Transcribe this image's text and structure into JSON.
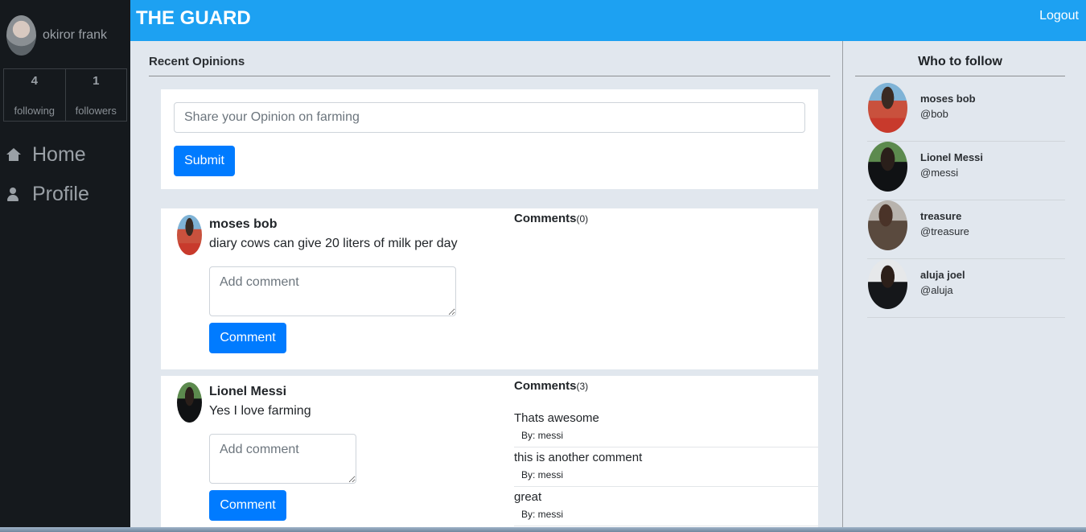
{
  "sidebar": {
    "user_name": "okiror frank",
    "following_count": "4",
    "following_label": "following",
    "followers_count": "1",
    "followers_label": "followers",
    "nav": [
      {
        "label": "Home",
        "icon": "home-icon"
      },
      {
        "label": "Profile",
        "icon": "user-icon"
      }
    ]
  },
  "header": {
    "brand": "THE GUARD",
    "logout_label": "Logout"
  },
  "main": {
    "section_title": "Recent Opinions",
    "composer": {
      "placeholder": "Share your Opinion on farming",
      "submit_label": "Submit"
    },
    "posts": [
      {
        "author": "moses bob",
        "text": "diary cows can give 20 liters of milk per day",
        "comment_placeholder": "Add comment",
        "comment_button": "Comment",
        "comments_label": "Comments",
        "comments_count": "(0)",
        "comments": []
      },
      {
        "author": "Lionel Messi",
        "text": "Yes I love farming",
        "comment_placeholder": "Add comment",
        "comment_button": "Comment",
        "comments_label": "Comments",
        "comments_count": "(3)",
        "comments": [
          {
            "text": "Thats awesome",
            "by": "By: messi"
          },
          {
            "text": "this is another comment",
            "by": "By: messi"
          },
          {
            "text": "great",
            "by": "By: messi"
          }
        ]
      }
    ]
  },
  "who_to_follow": {
    "title": "Who to follow",
    "users": [
      {
        "name": "moses bob",
        "handle": "@bob"
      },
      {
        "name": "Lionel Messi",
        "handle": "@messi"
      },
      {
        "name": "treasure",
        "handle": "@treasure"
      },
      {
        "name": "aluja joel",
        "handle": "@aluja"
      }
    ]
  }
}
